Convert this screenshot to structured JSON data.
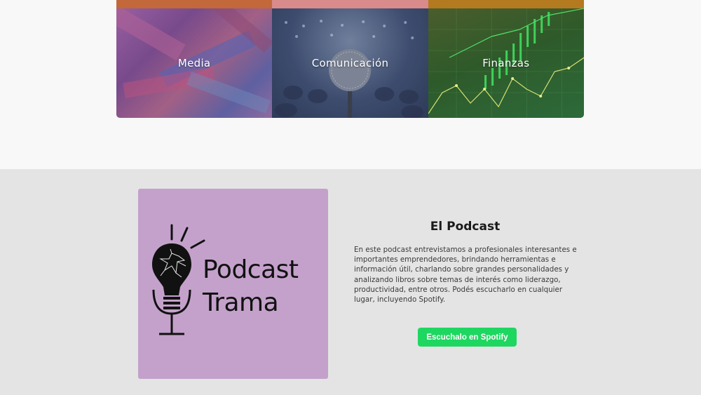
{
  "categories": {
    "items": [
      {
        "label": "Media"
      },
      {
        "label": "Comunicación"
      },
      {
        "label": "Finanzas"
      }
    ]
  },
  "podcast": {
    "cover": {
      "line1": "Podcast",
      "line2": "Trama",
      "bg_color": "#c4a1cb"
    },
    "title": "El Podcast",
    "description": "En este podcast entrevistamos a profesionales interesantes e importantes emprendedores, brindando herramientas e información útil, charlando sobre grandes personalidades y analizando libros sobre temas de interés como liderazgo, productividad, entre otros. Podés escucharlo en cualquier lugar, incluyendo Spotify.",
    "spotify_button": "Escuchalo en Spotify",
    "button_color": "#1ed760",
    "section_bg": "#e4e4e4"
  }
}
